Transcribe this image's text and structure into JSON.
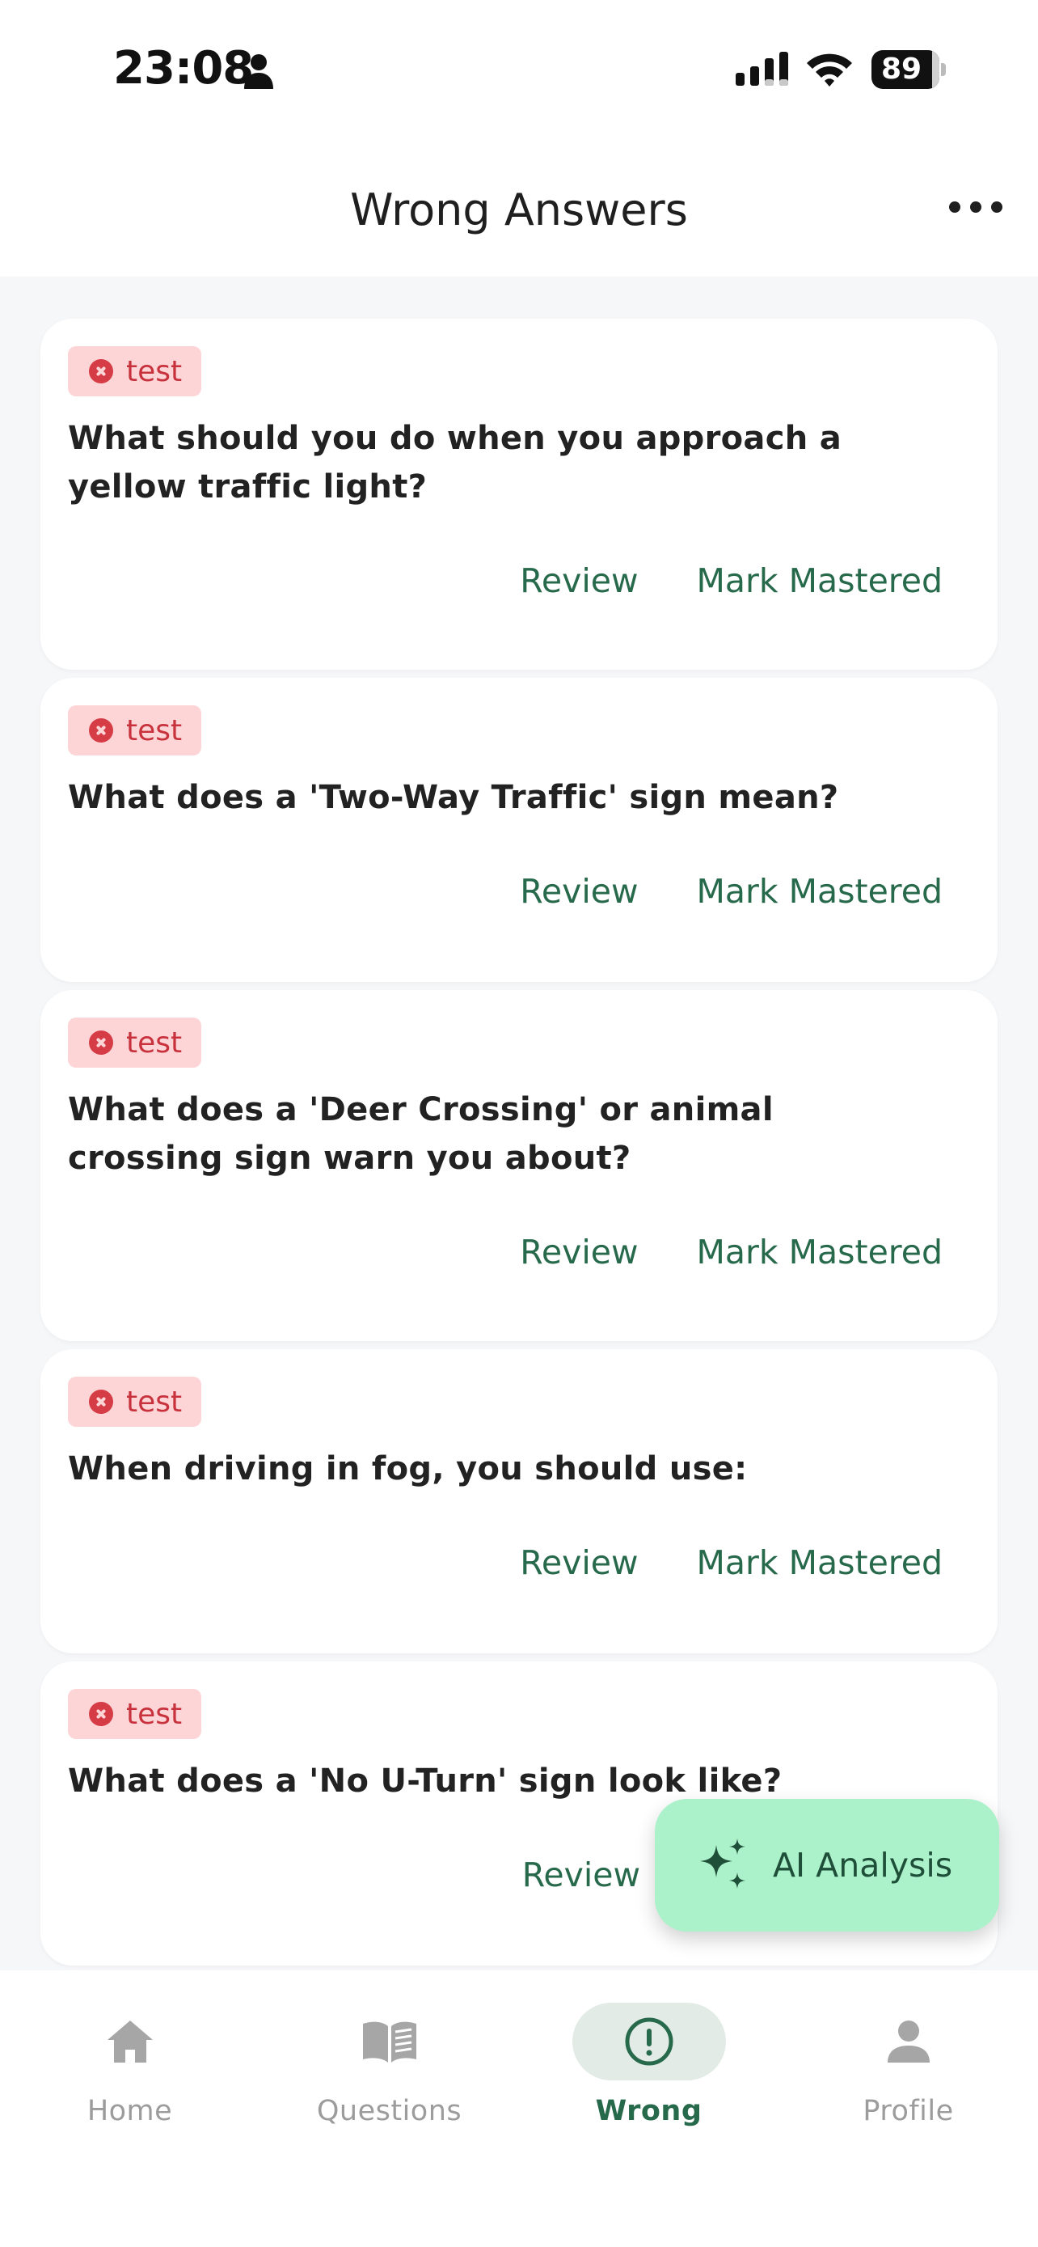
{
  "status_bar": {
    "time": "23:08",
    "battery": "89",
    "battery_level": 0.89
  },
  "header": {
    "title": "Wrong Answers"
  },
  "cards": [
    {
      "tag": "test",
      "question": "What should you do when you approach a yellow traffic light?",
      "review_label": "Review",
      "mastered_label": "Mark Mastered"
    },
    {
      "tag": "test",
      "question": "What does a 'Two-Way Traffic' sign mean?",
      "review_label": "Review",
      "mastered_label": "Mark Mastered"
    },
    {
      "tag": "test",
      "question": "What does a 'Deer Crossing' or animal crossing sign warn you about?",
      "review_label": "Review",
      "mastered_label": "Mark Mastered"
    },
    {
      "tag": "test",
      "question": "When driving in fog, you should use:",
      "review_label": "Review",
      "mastered_label": "Mark Mastered"
    },
    {
      "tag": "test",
      "question": "What does a 'No U-Turn' sign look like?",
      "review_label": "Review"
    }
  ],
  "fab": {
    "label": "AI Analysis",
    "icon": "sparkle-icon"
  },
  "nav": {
    "items": [
      {
        "label": "Home",
        "icon": "home-icon"
      },
      {
        "label": "Questions",
        "icon": "book-icon"
      },
      {
        "label": "Wrong",
        "icon": "alert-circle-icon",
        "active": true
      },
      {
        "label": "Profile",
        "icon": "person-icon"
      }
    ]
  },
  "colors": {
    "accent": "#27694b",
    "tag_background": "#fdd5d7",
    "tag_text": "#c8323d",
    "fab_background": "#abf2cb",
    "page_background": "#f6f7f9"
  }
}
